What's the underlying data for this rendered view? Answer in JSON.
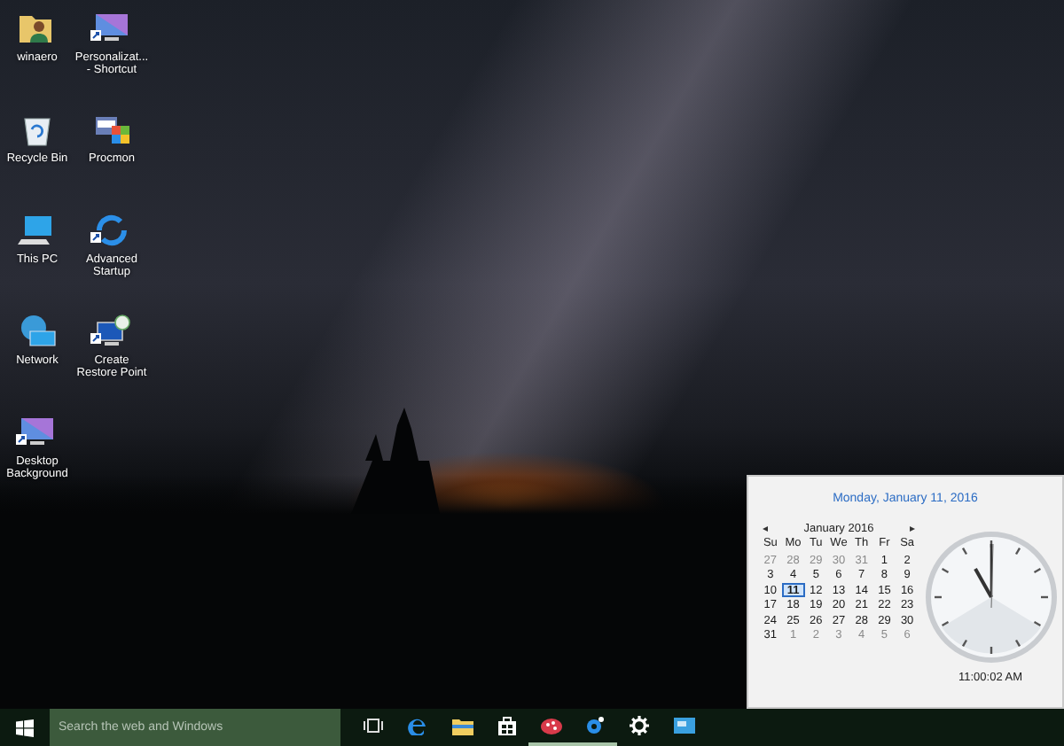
{
  "desktop_icons": [
    {
      "label": "winaero",
      "kind": "user-folder",
      "shortcut": false
    },
    {
      "label": "Personalizat... - Shortcut",
      "kind": "monitor",
      "shortcut": true
    },
    {
      "label": "Recycle Bin",
      "kind": "recycle-bin",
      "shortcut": false
    },
    {
      "label": "Procmon",
      "kind": "app-window",
      "shortcut": false
    },
    {
      "label": "This PC",
      "kind": "computer",
      "shortcut": false
    },
    {
      "label": "Advanced Startup",
      "kind": "sync",
      "shortcut": true
    },
    {
      "label": "Network",
      "kind": "network",
      "shortcut": false
    },
    {
      "label": "Create Restore Point",
      "kind": "restore",
      "shortcut": true
    },
    {
      "label": "Desktop Background",
      "kind": "monitor",
      "shortcut": true
    }
  ],
  "clock_popup": {
    "date": "Monday, January 11, 2016",
    "month": "January 2016",
    "prev": "◂",
    "next": "▸",
    "weekdays": [
      "Su",
      "Mo",
      "Tu",
      "We",
      "Th",
      "Fr",
      "Sa"
    ],
    "days": [
      {
        "day": "27",
        "other_month": true,
        "selected": false
      },
      {
        "day": "28",
        "other_month": true,
        "selected": false
      },
      {
        "day": "29",
        "other_month": true,
        "selected": false
      },
      {
        "day": "30",
        "other_month": true,
        "selected": false
      },
      {
        "day": "31",
        "other_month": true,
        "selected": false
      },
      {
        "day": "1",
        "other_month": false,
        "selected": false
      },
      {
        "day": "2",
        "other_month": false,
        "selected": false
      },
      {
        "day": "3",
        "other_month": false,
        "selected": false
      },
      {
        "day": "4",
        "other_month": false,
        "selected": false
      },
      {
        "day": "5",
        "other_month": false,
        "selected": false
      },
      {
        "day": "6",
        "other_month": false,
        "selected": false
      },
      {
        "day": "7",
        "other_month": false,
        "selected": false
      },
      {
        "day": "8",
        "other_month": false,
        "selected": false
      },
      {
        "day": "9",
        "other_month": false,
        "selected": false
      },
      {
        "day": "10",
        "other_month": false,
        "selected": false
      },
      {
        "day": "11",
        "other_month": false,
        "selected": true
      },
      {
        "day": "12",
        "other_month": false,
        "selected": false
      },
      {
        "day": "13",
        "other_month": false,
        "selected": false
      },
      {
        "day": "14",
        "other_month": false,
        "selected": false
      },
      {
        "day": "15",
        "other_month": false,
        "selected": false
      },
      {
        "day": "16",
        "other_month": false,
        "selected": false
      },
      {
        "day": "17",
        "other_month": false,
        "selected": false
      },
      {
        "day": "18",
        "other_month": false,
        "selected": false
      },
      {
        "day": "19",
        "other_month": false,
        "selected": false
      },
      {
        "day": "20",
        "other_month": false,
        "selected": false
      },
      {
        "day": "21",
        "other_month": false,
        "selected": false
      },
      {
        "day": "22",
        "other_month": false,
        "selected": false
      },
      {
        "day": "23",
        "other_month": false,
        "selected": false
      },
      {
        "day": "24",
        "other_month": false,
        "selected": false
      },
      {
        "day": "25",
        "other_month": false,
        "selected": false
      },
      {
        "day": "26",
        "other_month": false,
        "selected": false
      },
      {
        "day": "27",
        "other_month": false,
        "selected": false
      },
      {
        "day": "28",
        "other_month": false,
        "selected": false
      },
      {
        "day": "29",
        "other_month": false,
        "selected": false
      },
      {
        "day": "30",
        "other_month": false,
        "selected": false
      },
      {
        "day": "31",
        "other_month": false,
        "selected": false
      },
      {
        "day": "1",
        "other_month": true,
        "selected": false
      },
      {
        "day": "2",
        "other_month": true,
        "selected": false
      },
      {
        "day": "3",
        "other_month": true,
        "selected": false
      },
      {
        "day": "4",
        "other_month": true,
        "selected": false
      },
      {
        "day": "5",
        "other_month": true,
        "selected": false
      },
      {
        "day": "6",
        "other_month": true,
        "selected": false
      }
    ],
    "time": "11:00:02 AM"
  },
  "taskbar": {
    "search": {
      "placeholder": "Search the web and Windows"
    },
    "icons": [
      {
        "kind": "task-view",
        "running": false
      },
      {
        "kind": "edge",
        "running": false
      },
      {
        "kind": "folder",
        "running": false
      },
      {
        "kind": "store",
        "running": false
      },
      {
        "kind": "paint",
        "running": true
      },
      {
        "kind": "gear-app",
        "running": true
      },
      {
        "kind": "settings",
        "running": false
      },
      {
        "kind": "remote",
        "running": false
      }
    ]
  }
}
